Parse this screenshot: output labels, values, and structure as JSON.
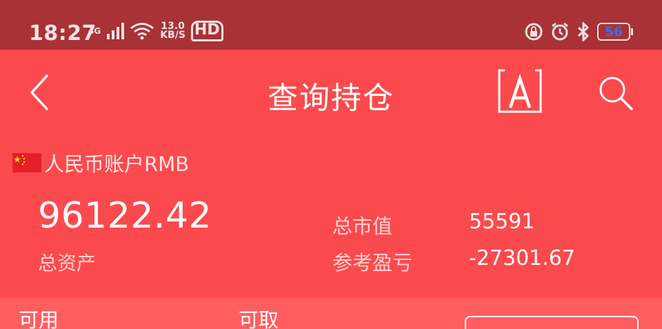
{
  "status_bar": {
    "time": "18:27",
    "network_type": "4G",
    "speed_value": "13.0",
    "speed_unit": "KB/S",
    "hd_label": "HD",
    "battery_level": "56"
  },
  "header": {
    "title": "查询持仓"
  },
  "account": {
    "name": "人民币账户RMB"
  },
  "summary": {
    "total_assets_value": "96122.42",
    "total_assets_label": "总资产",
    "market_value_label": "总市值",
    "market_value": "55591",
    "pnl_label": "参考盈亏",
    "pnl_value": "-27301.67"
  },
  "funds": {
    "available_label": "可用",
    "withdrawable_label": "可取"
  },
  "colors": {
    "background": "#fb4a4d",
    "status_bar": "#a83235",
    "battery_text": "#3b6fe0"
  }
}
